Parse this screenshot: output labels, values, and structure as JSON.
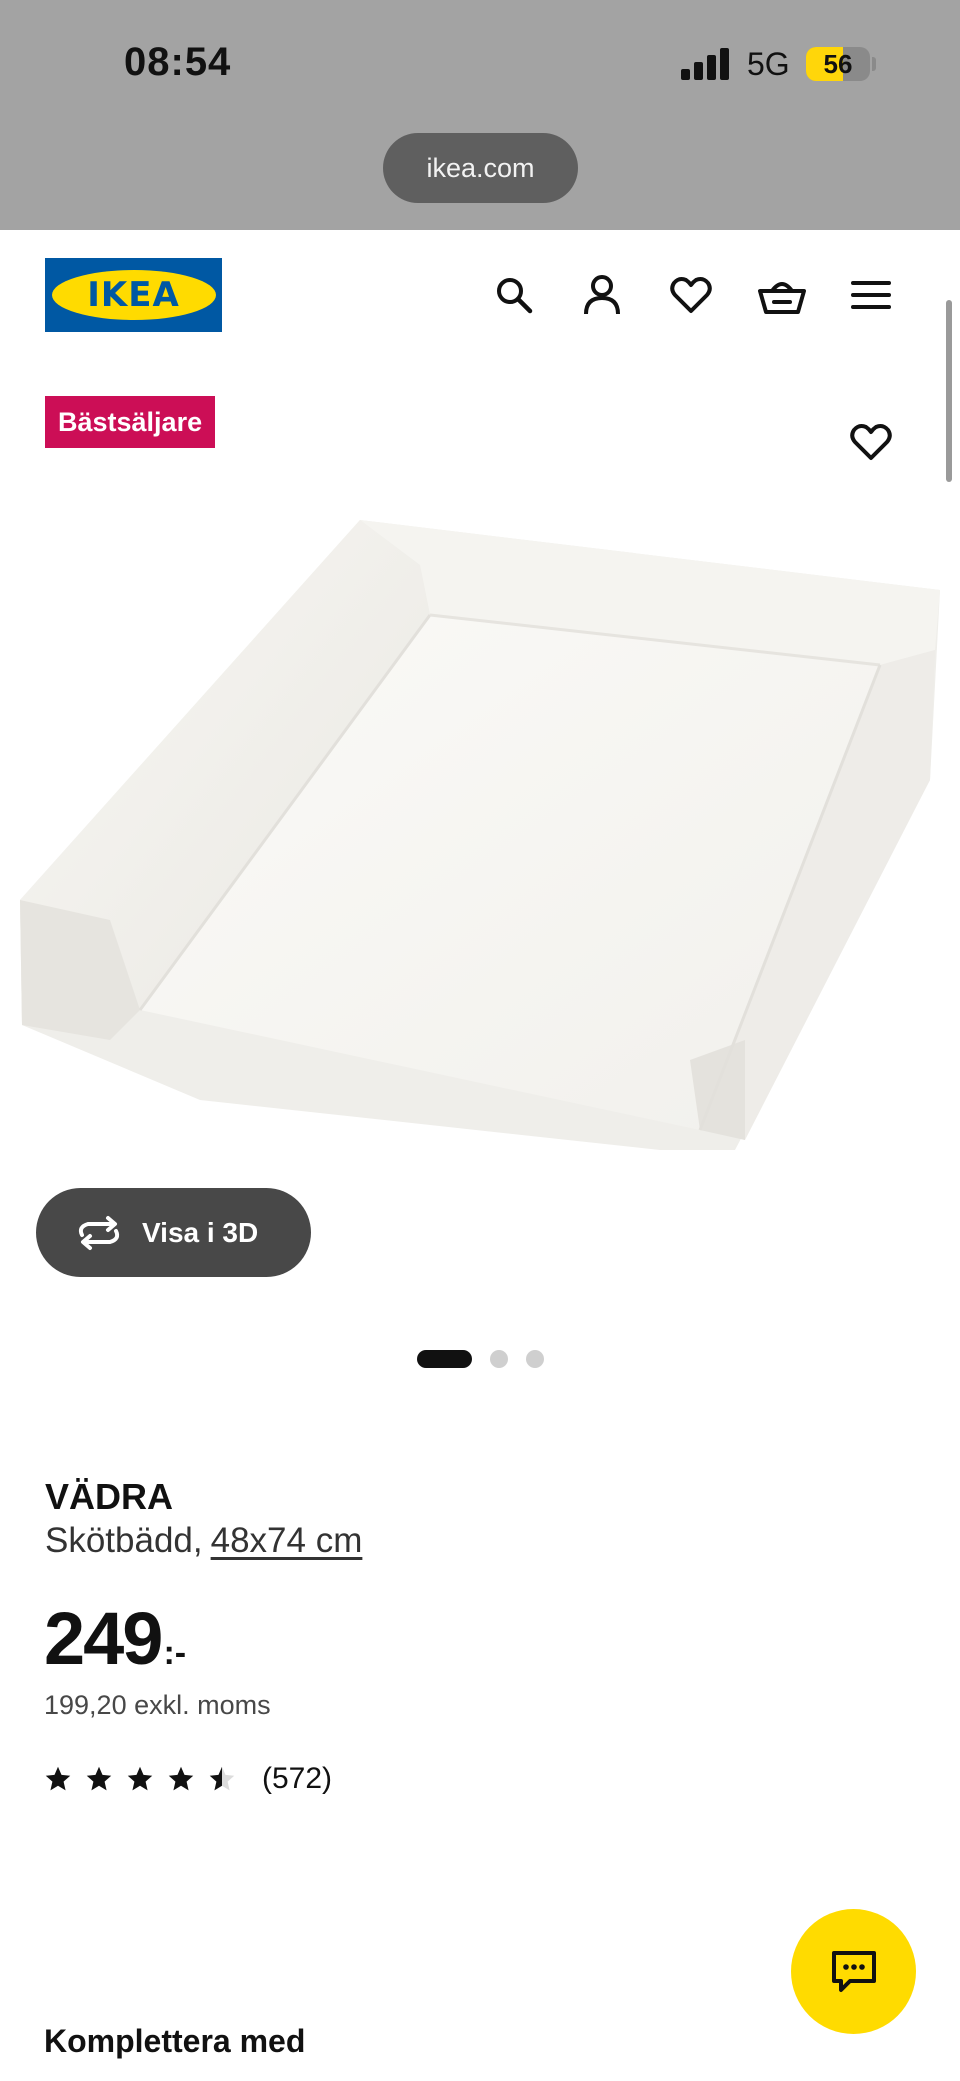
{
  "status_bar": {
    "time": "08:54",
    "network": "5G",
    "battery": "56",
    "battery_level": 0.56
  },
  "browser": {
    "url": "ikea.com"
  },
  "header": {
    "logo_text": "IKEA",
    "icons": [
      "search-icon",
      "account-icon",
      "heart-icon",
      "basket-icon",
      "menu-icon"
    ]
  },
  "product": {
    "badge": "Bästsäljare",
    "view_3d_label": "Visa i 3D",
    "image_count": 3,
    "active_image": 1,
    "name": "VÄDRA",
    "description": "Skötbädd,",
    "size": "48x74 cm",
    "price": "249",
    "currency": ":-",
    "price_excl_vat": "199,20 exkl. moms",
    "rating": 4.5,
    "rating_max": 5,
    "review_count": "(572)"
  },
  "sections": {
    "complement_heading": "Komplettera med"
  },
  "colors": {
    "ikea_blue": "#0058a3",
    "ikea_yellow": "#ffdb00",
    "badge_red": "#cc0e56"
  }
}
